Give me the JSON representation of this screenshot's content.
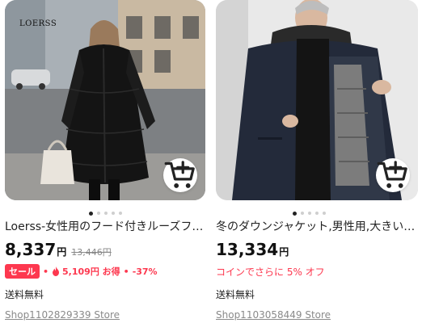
{
  "colors": {
    "accent": "#fd384f",
    "text": "#222222",
    "muted": "#888888"
  },
  "products": [
    {
      "brand_mark": "LOERSS",
      "title": "Loerss-女性用のフード付きルーズフ…",
      "price": "8,337",
      "currency": "円",
      "original_price": "13,446円",
      "sale_badge": "セール",
      "discount_amount": "5,109円 お得",
      "discount_percent": "-37%",
      "shipping": "送料無料",
      "store": "Shop1102829339 Store",
      "icons": [
        "add-to-cart-icon",
        "flame-icon"
      ]
    },
    {
      "title": "冬のダウンジャケット,男性用,大きい…",
      "price": "13,334",
      "currency": "円",
      "coin_promo": "コインでさらに 5% オフ",
      "shipping": "送料無料",
      "store": "Shop1103058449 Store",
      "icons": [
        "add-to-cart-icon"
      ]
    }
  ]
}
